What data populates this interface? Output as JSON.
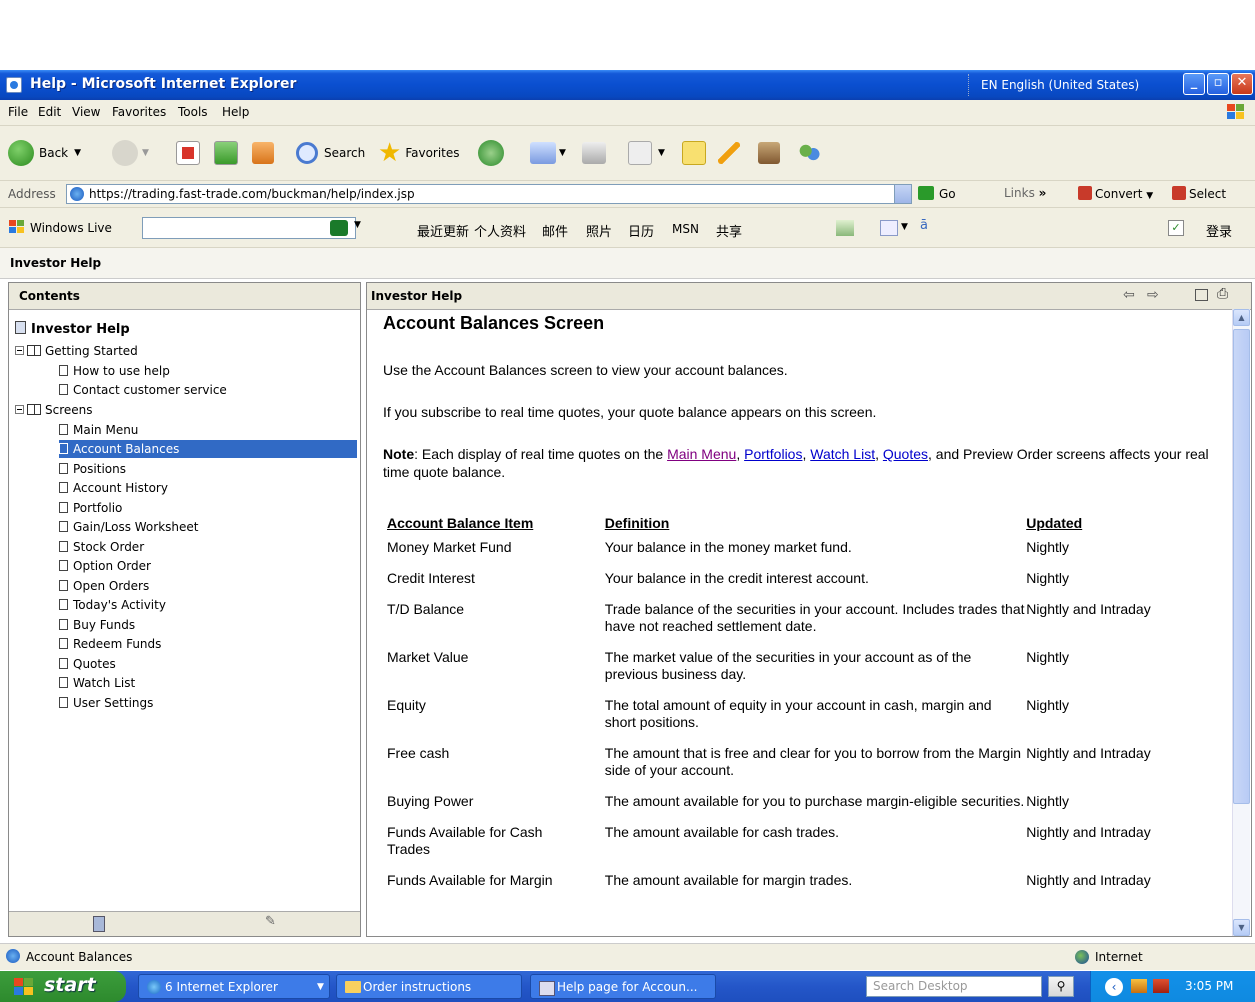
{
  "window": {
    "title": "Help - Microsoft Internet Explorer",
    "language": "EN English (United States)"
  },
  "menu": [
    "File",
    "Edit",
    "View",
    "Favorites",
    "Tools",
    "Help"
  ],
  "toolbar": {
    "back": "Back",
    "search": "Search",
    "favorites": "Favorites"
  },
  "address": {
    "label": "Address",
    "url": "https://trading.fast-trade.com/buckman/help/index.jsp",
    "go": "Go",
    "links": "Links",
    "convert": "Convert",
    "select": "Select"
  },
  "live": {
    "label": "Windows Live",
    "links": [
      "最近更新",
      "个人资料",
      "邮件",
      "照片",
      "日历",
      "MSN",
      "共享"
    ],
    "login": "登录"
  },
  "app": {
    "header": "Investor Help"
  },
  "contents": {
    "title": "Contents",
    "root": "Investor Help",
    "groups": [
      {
        "label": "Getting Started",
        "items": [
          "How to use help",
          "Contact customer service"
        ]
      },
      {
        "label": "Screens",
        "items": [
          "Main Menu",
          "Account Balances",
          "Positions",
          "Account History",
          "Portfolio",
          "Gain/Loss Worksheet",
          "Stock Order",
          "Option Order",
          "Open Orders",
          "Today's Activity",
          "Buy Funds",
          "Redeem Funds",
          "Quotes",
          "Watch List",
          "User Settings"
        ]
      }
    ],
    "selected": "Account Balances"
  },
  "page": {
    "pane_title": "Investor Help",
    "heading": "Account Balances Screen",
    "intro": "Use the Account Balances screen to view your account balances.",
    "subscribe": "If you subscribe to real time quotes, your quote balance appears on this screen.",
    "note_label": "Note",
    "note_prefix": ":  Each display of real time quotes on the ",
    "note_links": [
      "Main Menu",
      "Portfolios",
      "Watch List",
      "Quotes"
    ],
    "note_sep1": ", ",
    "note_and": ", and Preview Order screens affects your real time quote balance.",
    "table": {
      "headers": [
        "Account Balance Item",
        "Definition",
        "Updated"
      ],
      "rows": [
        [
          "Money Market Fund",
          "Your balance in the money market fund.",
          "Nightly"
        ],
        [
          "Credit Interest",
          "Your balance in the credit interest account.",
          "Nightly"
        ],
        [
          "T/D Balance",
          "Trade balance of the securities in your account.  Includes trades that have not reached settlement date.",
          "Nightly and Intraday"
        ],
        [
          "Market Value",
          "The market value of the securities in your account as of the previous business day.",
          "Nightly"
        ],
        [
          "Equity",
          "The total amount of equity in your account in cash, margin and short positions.",
          "Nightly"
        ],
        [
          "Free cash",
          "The amount that is free and clear for you to borrow from the Margin side of your account.",
          "Nightly and Intraday"
        ],
        [
          "Buying Power",
          "The amount available for you to purchase margin-eligible securities.",
          "Nightly"
        ],
        [
          "Funds Available for Cash Trades",
          "The amount available for cash trades.",
          "Nightly and Intraday"
        ],
        [
          "Funds Available for Margin",
          "The amount available for margin trades.",
          "Nightly and Intraday"
        ]
      ]
    }
  },
  "status": {
    "text": "Account Balances",
    "zone": "Internet"
  },
  "taskbar": {
    "start": "start",
    "tasks": [
      "6 Internet Explorer",
      "Order instructions",
      "Help page for Accoun..."
    ],
    "search_placeholder": "Search Desktop",
    "clock": "3:05 PM"
  }
}
